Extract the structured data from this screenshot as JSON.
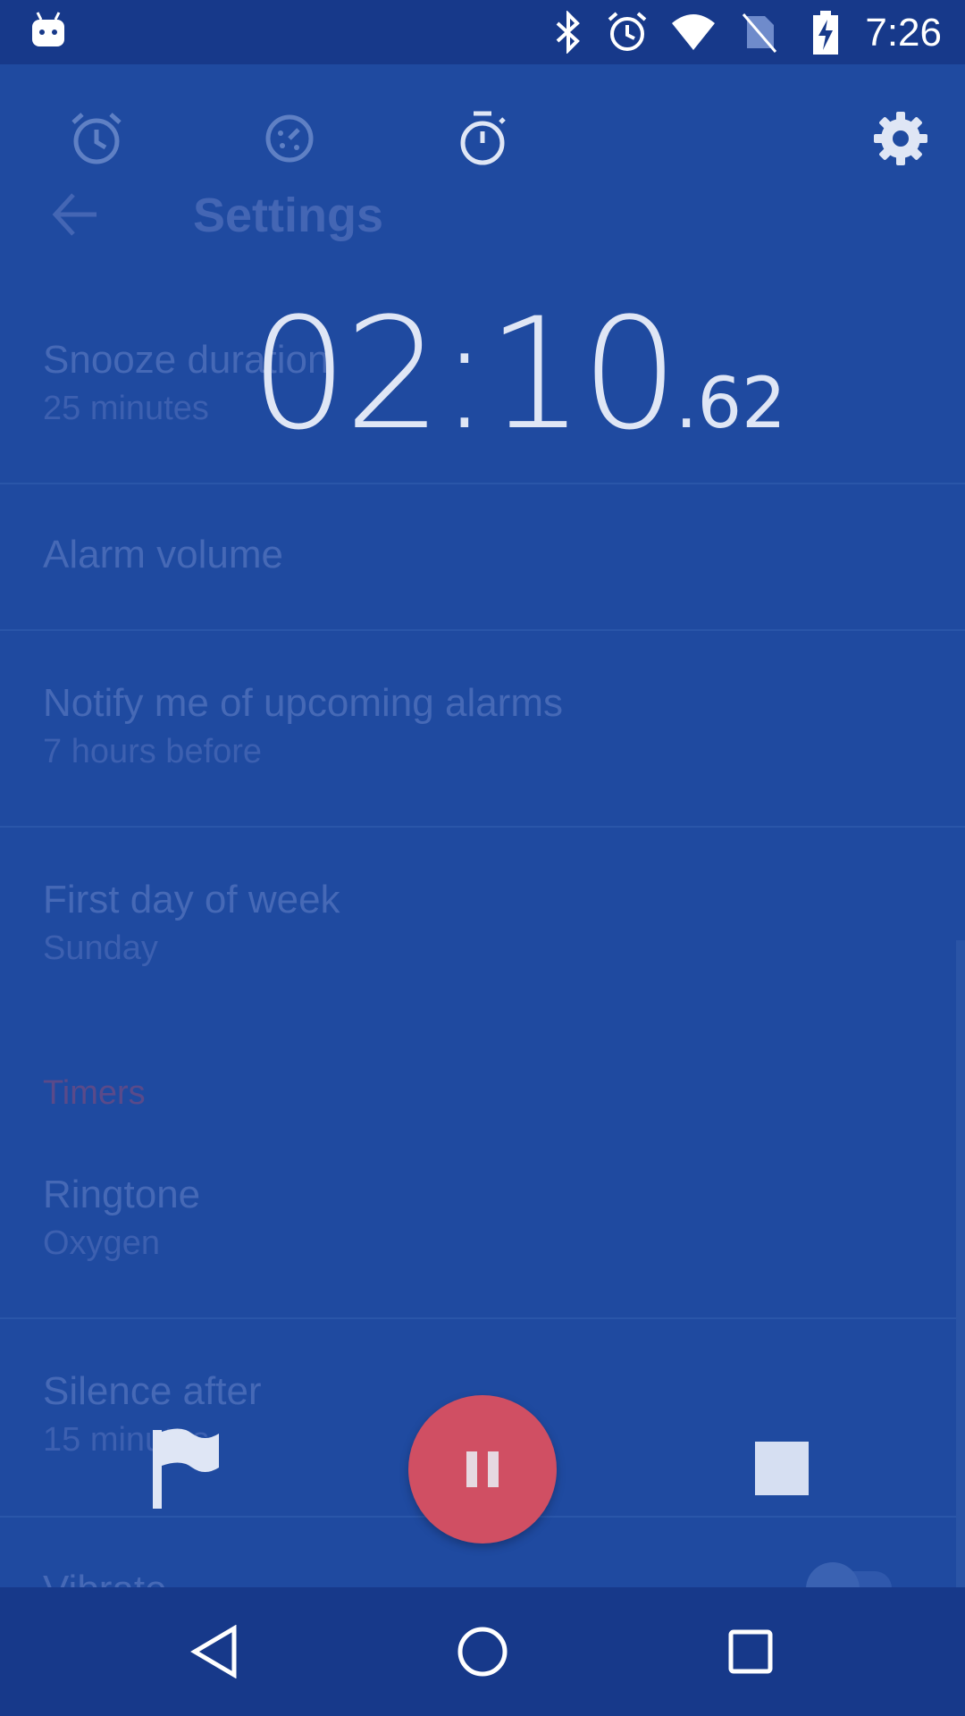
{
  "status_bar": {
    "time": "7:26",
    "icons": [
      "bluetooth-icon",
      "alarm-icon",
      "wifi-icon",
      "no-sim-icon",
      "battery-charging-icon"
    ],
    "app_notification_icon": "android-icon"
  },
  "tabs": [
    {
      "icon": "alarm-clock-icon",
      "selected": false
    },
    {
      "icon": "world-clock-icon",
      "selected": false
    },
    {
      "icon": "stopwatch-icon",
      "selected": true
    },
    {
      "icon": "gear-icon",
      "selected": false
    }
  ],
  "settings": {
    "title": "Settings",
    "items": [
      {
        "title": "Snooze duration",
        "subtitle": "25 minutes"
      },
      {
        "title": "Alarm volume",
        "subtitle": ""
      },
      {
        "title": "Notify me of upcoming alarms",
        "subtitle": "7 hours before"
      },
      {
        "title": "First day of week",
        "subtitle": "Sunday"
      },
      {
        "title": "Ringtone",
        "subtitle": "Oxygen"
      },
      {
        "title": "Silence after",
        "subtitle": "15 minutes"
      },
      {
        "title": "Vibrate",
        "subtitle": ""
      }
    ],
    "section_timers": "Timers"
  },
  "stopwatch": {
    "main": "02:10",
    "hundredths": ".62"
  },
  "controls": {
    "lap_icon": "flag-icon",
    "pause_icon": "pause-icon",
    "stop_icon": "stop-icon",
    "pause_color": "#d04f63"
  },
  "nav": [
    "back-icon",
    "home-icon",
    "recents-icon"
  ],
  "colors": {
    "background": "#1f4aa0",
    "status_bar": "#17398a",
    "dimmed_text": "#4669b6"
  }
}
